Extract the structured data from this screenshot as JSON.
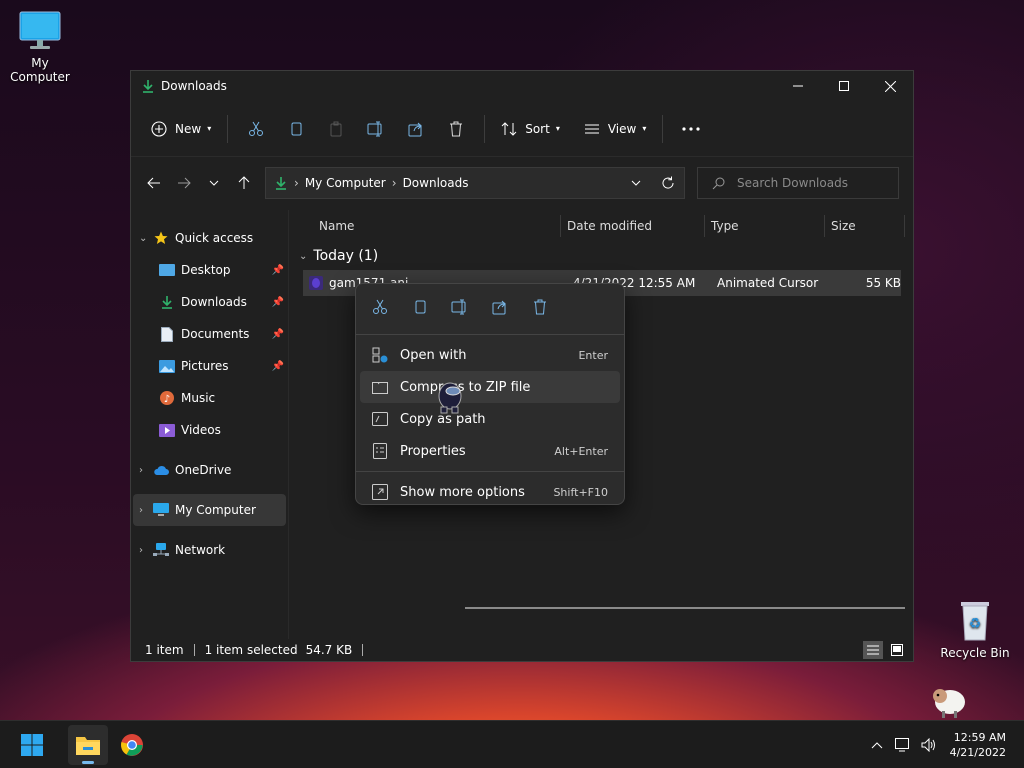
{
  "desktop": {
    "my_computer_label": "My Computer",
    "recycle_bin_label": "Recycle Bin"
  },
  "window": {
    "title": "Downloads",
    "toolbar": {
      "new_label": "New",
      "sort_label": "Sort",
      "view_label": "View"
    },
    "address": {
      "crumbs": [
        "My Computer",
        "Downloads"
      ]
    },
    "search": {
      "placeholder": "Search Downloads"
    },
    "sidebar": {
      "quick_access": "Quick access",
      "items": [
        "Desktop",
        "Downloads",
        "Documents",
        "Pictures",
        "Music",
        "Videos"
      ],
      "onedrive": "OneDrive",
      "my_computer": "My Computer",
      "network": "Network"
    },
    "columns": {
      "name": "Name",
      "date": "Date modified",
      "type": "Type",
      "size": "Size"
    },
    "group_label": "Today (1)",
    "file": {
      "name": "gam1571.ani",
      "date": "4/21/2022 12:55 AM",
      "type": "Animated Cursor",
      "size": "55 KB"
    },
    "status": {
      "count": "1 item",
      "selected": "1 item selected",
      "size": "54.7 KB"
    }
  },
  "context_menu": {
    "items": [
      {
        "label": "Open with",
        "shortcut": "Enter"
      },
      {
        "label": "Compress to ZIP file",
        "shortcut": ""
      },
      {
        "label": "Copy as path",
        "shortcut": ""
      },
      {
        "label": "Properties",
        "shortcut": "Alt+Enter"
      }
    ],
    "more": {
      "label": "Show more options",
      "shortcut": "Shift+F10"
    }
  },
  "taskbar": {
    "time": "12:59 AM",
    "date": "4/21/2022"
  },
  "colors": {
    "accent": "#76b9ed",
    "folder": "#f6c644",
    "downloads": "#2fb36b"
  }
}
